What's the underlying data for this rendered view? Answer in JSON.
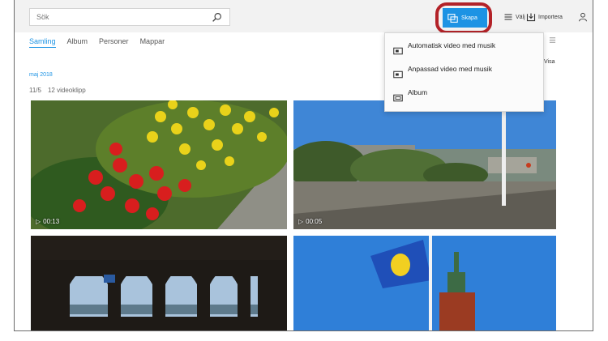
{
  "toolbar": {
    "search": {
      "placeholder": "Sök",
      "value": ""
    },
    "skapa_label": "Skapa",
    "valj_label": "Välj",
    "importera_label": "Importera"
  },
  "tabs": [
    {
      "label": "Samling",
      "active": true
    },
    {
      "label": "Album",
      "active": false
    },
    {
      "label": "Personer",
      "active": false
    },
    {
      "label": "Mappar",
      "active": false
    }
  ],
  "section": {
    "month": "maj 2018",
    "day": "11/5",
    "count": "12 videoklipp",
    "side_link": "Visa"
  },
  "photos": [
    {
      "subject": "red and yellow tulips",
      "duration": "00:13"
    },
    {
      "subject": "boulevard with trees and a flagpole",
      "duration": "00:05"
    },
    {
      "subject": "arcade with arches by the water",
      "duration": ""
    },
    {
      "subject": "flag on a flagpole in front of a tower",
      "duration": ""
    }
  ],
  "dropdown": {
    "items": [
      {
        "title": "Automatisk video med musik",
        "icon": "video-auto-icon"
      },
      {
        "title": "Anpassad video med musik",
        "icon": "video-custom-icon"
      },
      {
        "title": "Album",
        "icon": "album-icon"
      }
    ]
  },
  "colors": {
    "accent": "#1d93e4",
    "highlight": "#b32228",
    "toolbar_bg": "#f2f2f2"
  }
}
